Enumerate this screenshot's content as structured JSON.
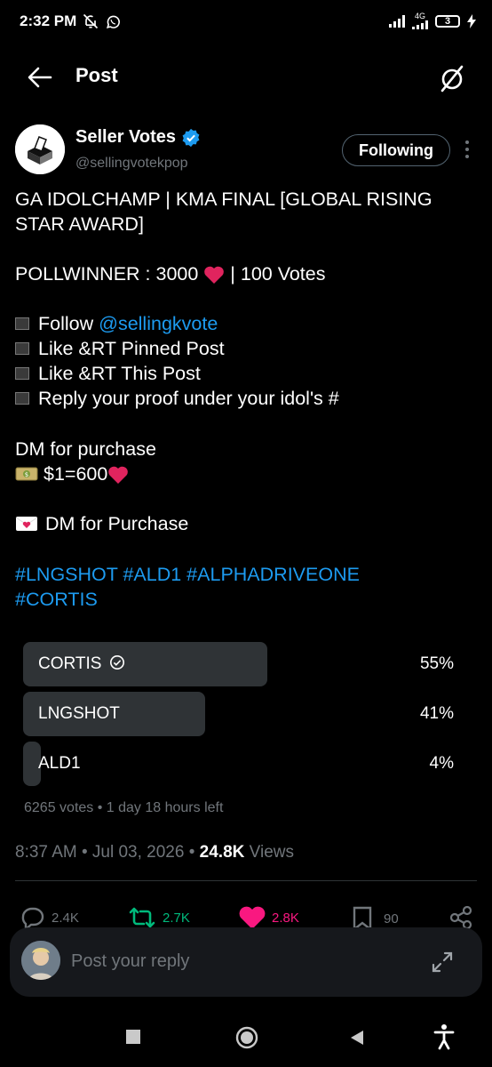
{
  "status_bar": {
    "time": "2:32 PM",
    "network": "4G",
    "battery": "3"
  },
  "header": {
    "title": "Post"
  },
  "author": {
    "name": "Seller Votes",
    "handle": "@sellingvotekpop",
    "follow_label": "Following"
  },
  "post": {
    "title_line": "GA IDOLCHAMP | KMA FINAL [GLOBAL RISING STAR AWARD]",
    "pollwinner_prefix": "POLLWINNER : 3000",
    "pollwinner_suffix": "| 100 Votes",
    "follow_prefix": "Follow",
    "follow_link": "@sellingkvote",
    "step2": "Like &RT Pinned Post",
    "step3": "Like &RT This Post",
    "step4": "Reply your proof under your idol's #",
    "dm_line": "DM for purchase",
    "price_line": "$1=600",
    "dm_line2": "DM for Purchase",
    "hashtags_line1": "#LNGSHOT #ALD1 #ALPHADRIVEONE",
    "hashtags_line2": "#CORTIS"
  },
  "poll": {
    "options": [
      {
        "label": "CORTIS",
        "percent": "55%",
        "fraction": 0.55,
        "winner": true
      },
      {
        "label": "LNGSHOT",
        "percent": "41%",
        "fraction": 0.41,
        "winner": false
      },
      {
        "label": "ALD1",
        "percent": "4%",
        "fraction": 0.04,
        "winner": false
      }
    ],
    "meta": "6265 votes • 1 day 18 hours left"
  },
  "meta": {
    "timestamp": "8:37 AM • Jul 03, 2026 • ",
    "views_count": "24.8K",
    "views_label": " Views"
  },
  "actions": {
    "replies": "2.4K",
    "reposts": "2.7K",
    "likes": "2.8K",
    "bookmarks": "90"
  },
  "reply_box": {
    "placeholder": "Post your reply"
  },
  "colors": {
    "accent": "#1d9bf0",
    "repost": "#00ba7c",
    "like": "#f91880",
    "muted": "#71767b"
  }
}
